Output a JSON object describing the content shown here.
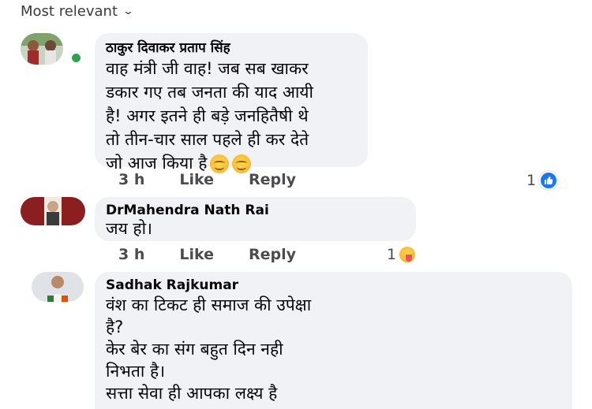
{
  "sort": {
    "label": "Most relevant"
  },
  "comments": [
    {
      "author": "ठाकुर दिवाकर प्रताप सिंह",
      "text": "वाह मंत्री जी वाह! जब सब खाकर\nडकार गए तब जनता की याद आयी\nहै! अगर इतने ही बड़े जनहितैषी थे\nतो तीन-चार साल पहले ही कर देते\nजो आज किया है",
      "emoji": "smiling-face-emoji x2",
      "time": "3 h",
      "like_label": "Like",
      "reply_label": "Reply",
      "reaction_count": "1",
      "reaction": "like-reaction",
      "online": true
    },
    {
      "author": "DrMahendra Nath Rai",
      "text": "जय हो।",
      "time": "3 h",
      "like_label": "Like",
      "reply_label": "Reply",
      "reaction_count": "1",
      "reaction": "haha-reaction"
    },
    {
      "author": "Sadhak Rajkumar",
      "text": "वंश का टिकट ही समाज की उपेक्षा\nहै?\n केर बेर का संग बहुत दिन नही\nनिभता है।\n सत्ता सेवा ही आपका लक्ष्य है"
    }
  ],
  "colors": {
    "bubble_bg": "#f0f2f5",
    "like_blue": "#1877f2",
    "online_green": "#31a24c",
    "meta_text": "#4b4c4f"
  }
}
